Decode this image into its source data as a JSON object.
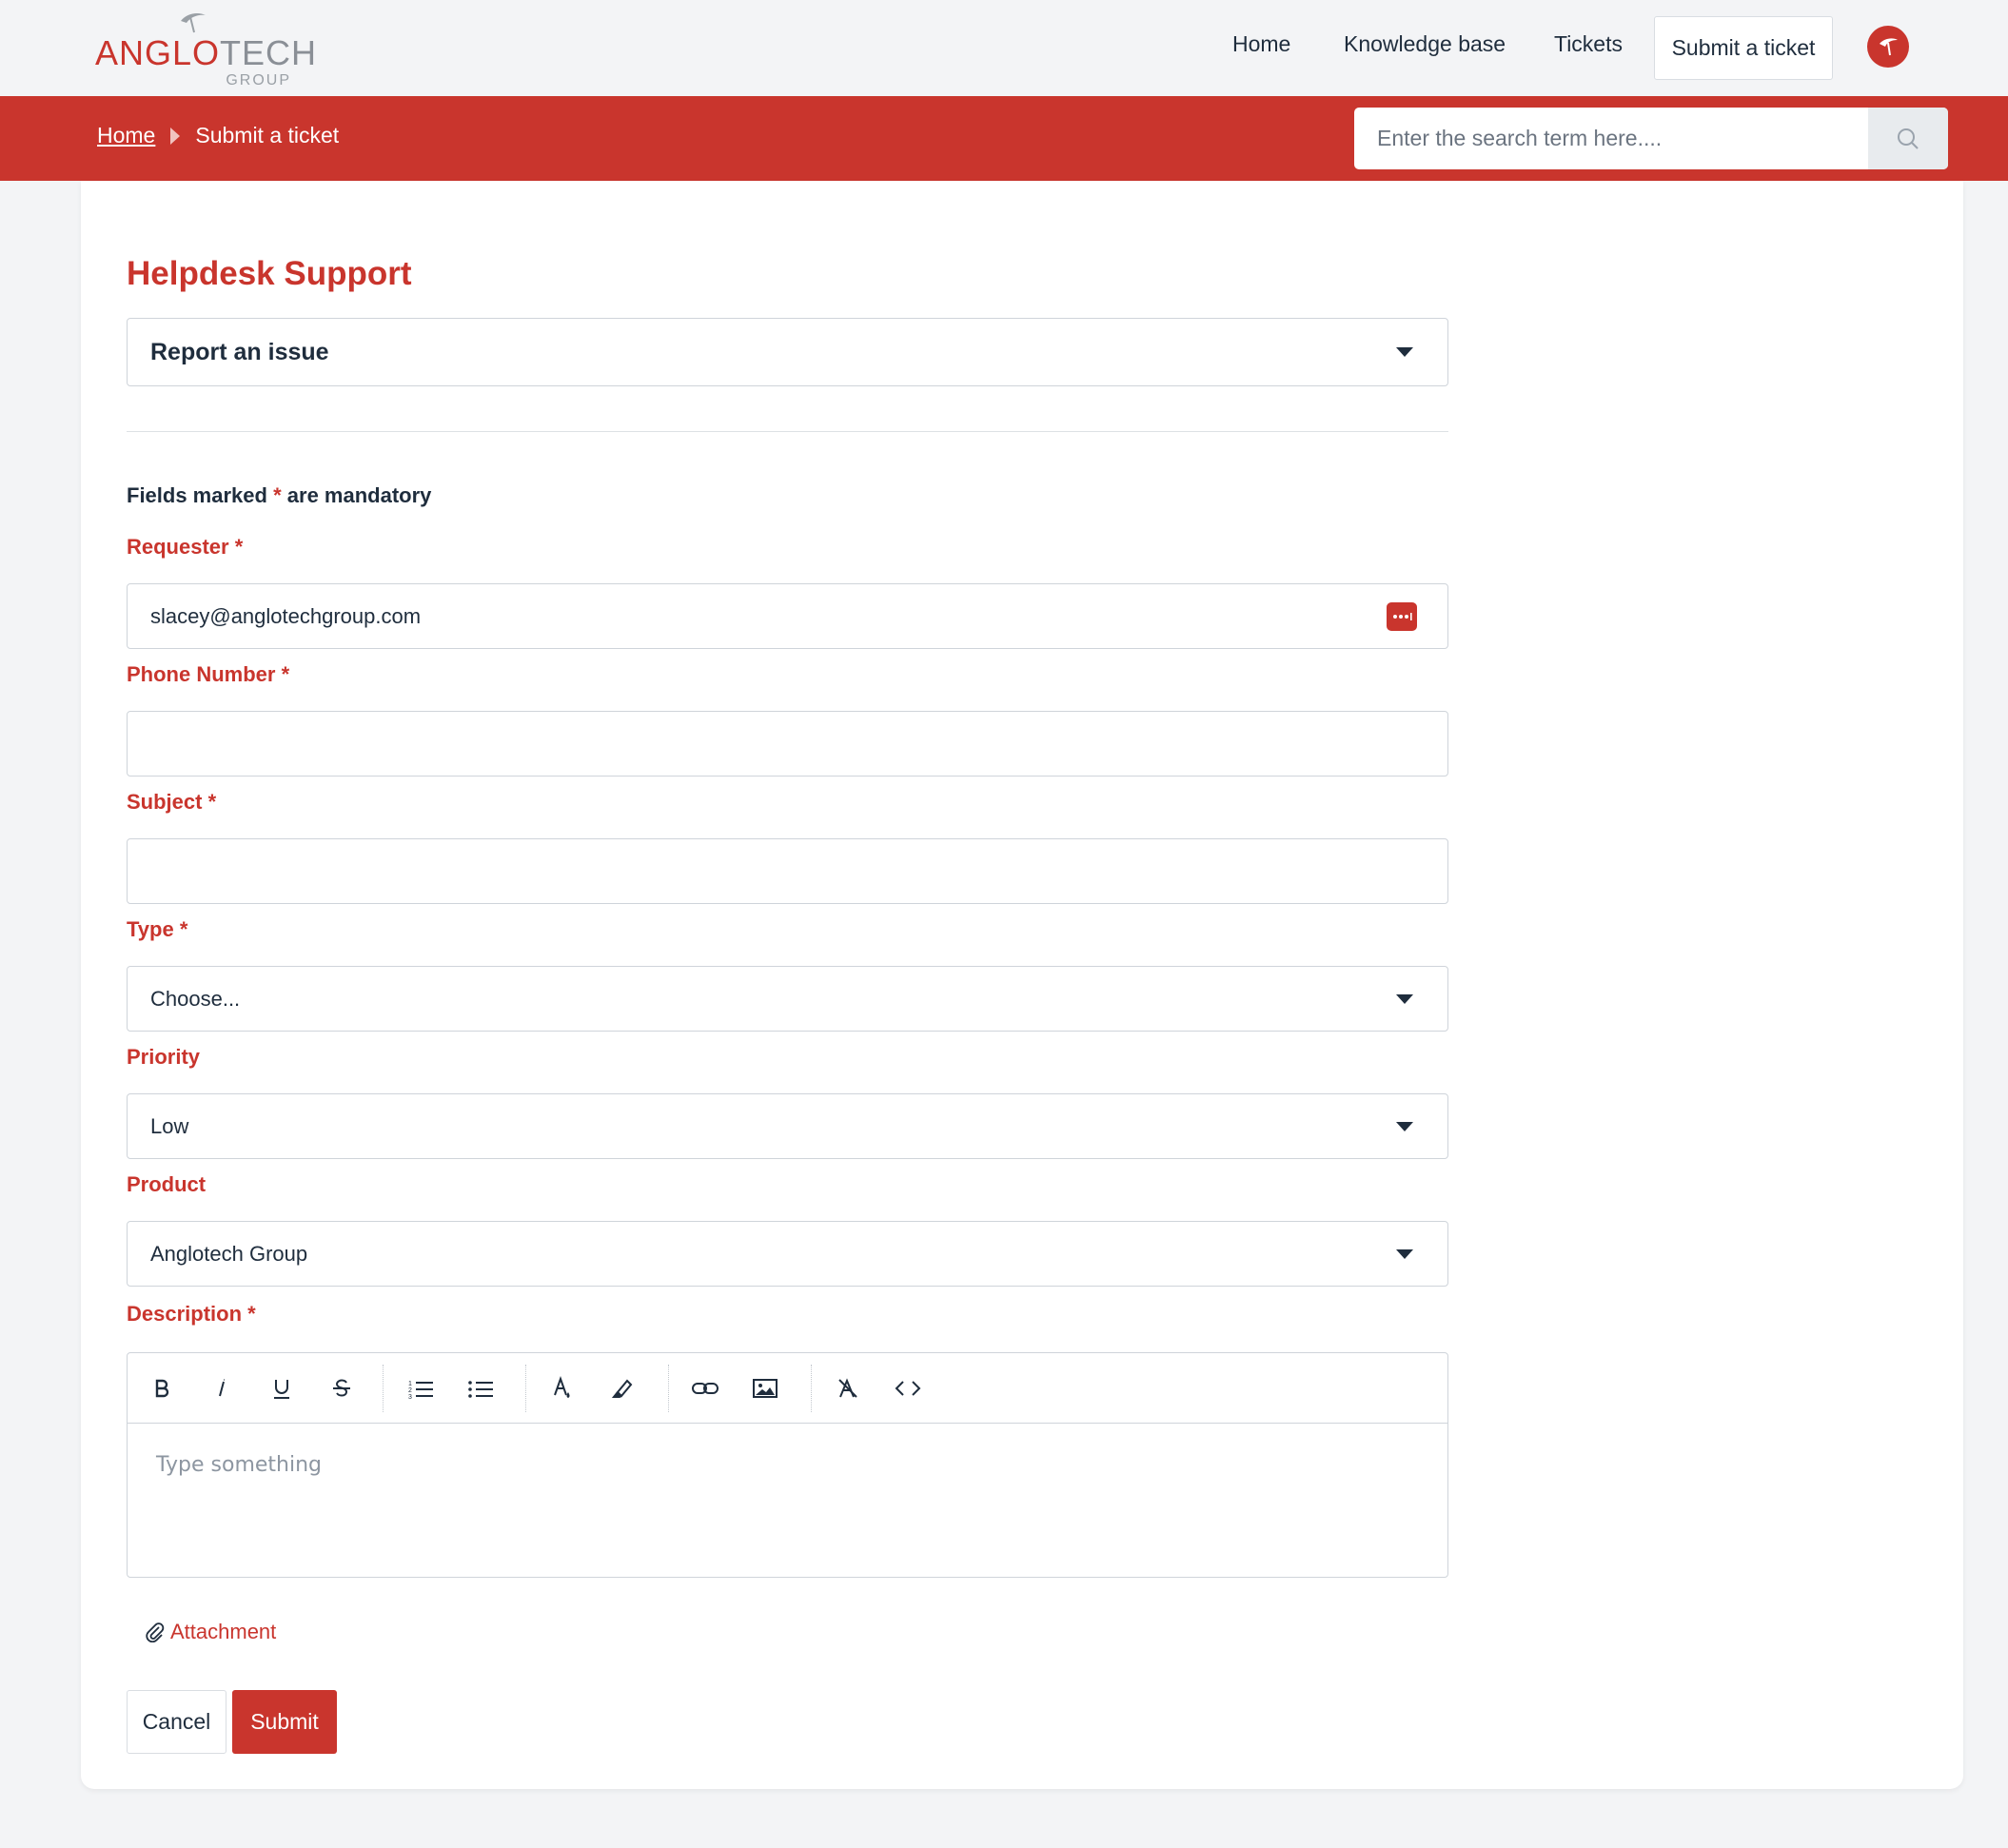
{
  "brand": {
    "logo_primary_red": "ANGLO",
    "logo_primary_gray": "TECH",
    "logo_sub": "GROUP",
    "accent_color": "#c9352d"
  },
  "nav": {
    "home": "Home",
    "knowledge_base": "Knowledge base",
    "tickets": "Tickets",
    "submit_ticket": "Submit a ticket"
  },
  "breadcrumb": {
    "home": "Home",
    "current": "Submit a ticket"
  },
  "search": {
    "placeholder": "Enter the search term here....",
    "icon": "search-icon"
  },
  "form": {
    "title": "Helpdesk Support",
    "form_type": "Report an issue",
    "mandatory_prefix": "Fields marked",
    "mandatory_star": "*",
    "mandatory_suffix": "are mandatory",
    "requester": {
      "label": "Requester *",
      "value": "slacey@anglotechgroup.com"
    },
    "phone": {
      "label": "Phone Number *",
      "value": ""
    },
    "subject": {
      "label": "Subject *",
      "value": ""
    },
    "type": {
      "label": "Type *",
      "value": "Choose..."
    },
    "priority": {
      "label": "Priority",
      "value": "Low"
    },
    "product": {
      "label": "Product",
      "value": "Anglotech Group"
    },
    "description": {
      "label": "Description *",
      "placeholder": "Type something"
    },
    "attachment": "Attachment",
    "cancel": "Cancel",
    "submit": "Submit"
  },
  "toolbar_icons": [
    "bold-icon",
    "italic-icon",
    "underline-icon",
    "strikethrough-icon",
    "ordered-list-icon",
    "bullet-list-icon",
    "text-color-icon",
    "highlight-icon",
    "link-icon",
    "image-icon",
    "clear-format-icon",
    "code-icon"
  ]
}
